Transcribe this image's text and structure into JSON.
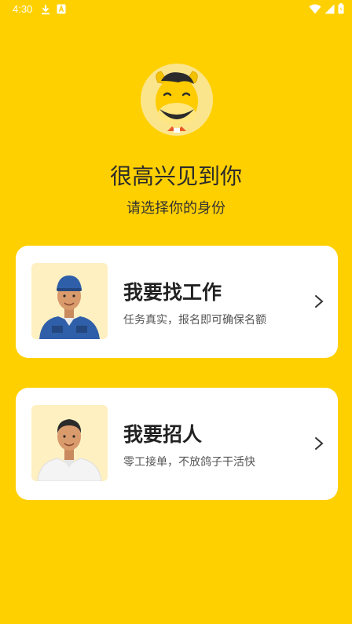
{
  "status_bar": {
    "time": "4:30",
    "icons": [
      "download-icon",
      "notification-a-icon",
      "wifi-icon",
      "signal-icon",
      "battery-icon"
    ]
  },
  "welcome": {
    "title": "很高兴见到你",
    "subtitle": "请选择你的身份"
  },
  "roles": [
    {
      "title": "我要找工作",
      "description": "任务真实，报名即可确保名额",
      "icon": "chevron-right-icon"
    },
    {
      "title": "我要招人",
      "description": "零工接单，不放鸽子干活快",
      "icon": "chevron-right-icon"
    }
  ],
  "colors": {
    "background": "#FFD000",
    "card": "#FFFFFF",
    "photo_bg": "#FFF0C2",
    "mascot_bg": "#FBE58C"
  }
}
